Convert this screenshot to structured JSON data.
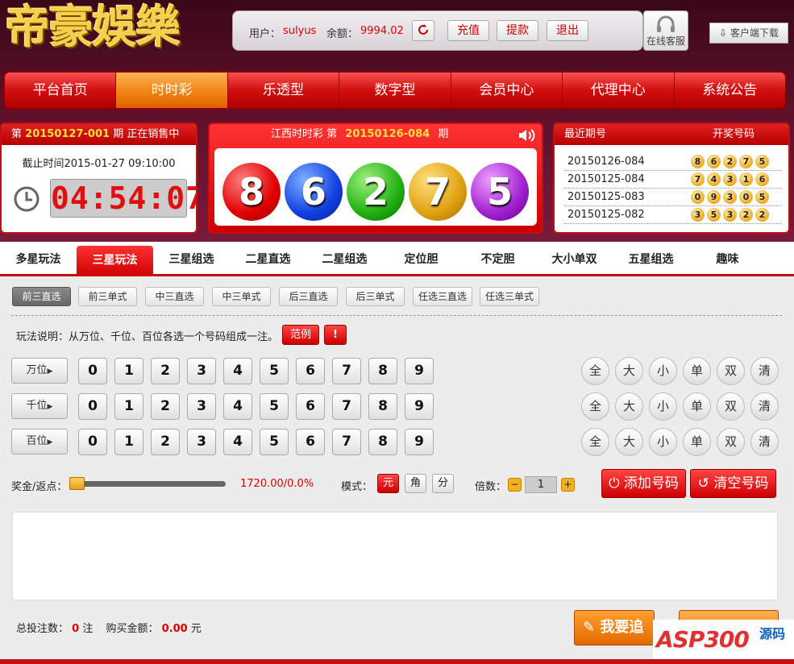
{
  "logo": "帝豪娛樂",
  "account": {
    "user_label": "用户：",
    "username": "sulyus",
    "balance_label": "余额：",
    "balance": "9994.02",
    "recharge": "充值",
    "withdraw": "提款",
    "logout": "退出",
    "support": "在线客服",
    "download": "客户端下载"
  },
  "nav": [
    "平台首页",
    "时时彩",
    "乐透型",
    "数字型",
    "会员中心",
    "代理中心",
    "系统公告"
  ],
  "current": {
    "prefix": "第",
    "issue": "20150127-001",
    "suffix": "期 正在销售中",
    "deadline_label": "截止时间",
    "deadline": "2015-01-27 09:10:00",
    "countdown": "04:54:07"
  },
  "draw": {
    "prefix": "江西时时彩 第",
    "issue": "20150126-084",
    "suffix": "期",
    "balls": [
      "8",
      "6",
      "2",
      "7",
      "5"
    ]
  },
  "recent": {
    "col1": "最近期号",
    "col2": "开奖号码",
    "rows": [
      {
        "issue": "20150126-084",
        "nums": [
          "8",
          "6",
          "2",
          "7",
          "5"
        ]
      },
      {
        "issue": "20150125-084",
        "nums": [
          "7",
          "4",
          "3",
          "1",
          "6"
        ]
      },
      {
        "issue": "20150125-083",
        "nums": [
          "0",
          "9",
          "3",
          "0",
          "5"
        ]
      },
      {
        "issue": "20150125-082",
        "nums": [
          "3",
          "5",
          "3",
          "2",
          "2"
        ]
      }
    ]
  },
  "tabs": [
    "多星玩法",
    "三星玩法",
    "三星组选",
    "二星直选",
    "二星组选",
    "定位胆",
    "不定胆",
    "大小单双",
    "五星组选",
    "趣味"
  ],
  "subtabs": [
    "前三直选",
    "前三单式",
    "中三直选",
    "中三单式",
    "后三直选",
    "后三单式",
    "任选三直选",
    "任选三单式"
  ],
  "rule": {
    "text": "玩法说明：从万位、千位、百位各选一个号码组成一注。",
    "example": "范例",
    "warn": "!"
  },
  "positions": [
    "万位",
    "千位",
    "百位"
  ],
  "digits": [
    "0",
    "1",
    "2",
    "3",
    "4",
    "5",
    "6",
    "7",
    "8",
    "9"
  ],
  "quick": [
    "全",
    "大",
    "小",
    "单",
    "双",
    "清"
  ],
  "bonus": {
    "label": "奖金/返点：",
    "value": "1720.00/0.0%",
    "mode_label": "模式：",
    "modes": [
      "元",
      "角",
      "分"
    ],
    "multiple_label": "倍数：",
    "multiple": "1",
    "minus": "−",
    "plus": "+"
  },
  "actions": {
    "add": "添加号码",
    "clear": "清空号码",
    "chase": "我要追"
  },
  "summary": {
    "count_label": "总投注数：",
    "count": "0",
    "count_unit": "注",
    "amount_label": "购买金额：",
    "amount": "0.00",
    "amount_unit": "元"
  },
  "watermark": {
    "brand": "ASP300",
    "sub": "源码"
  }
}
